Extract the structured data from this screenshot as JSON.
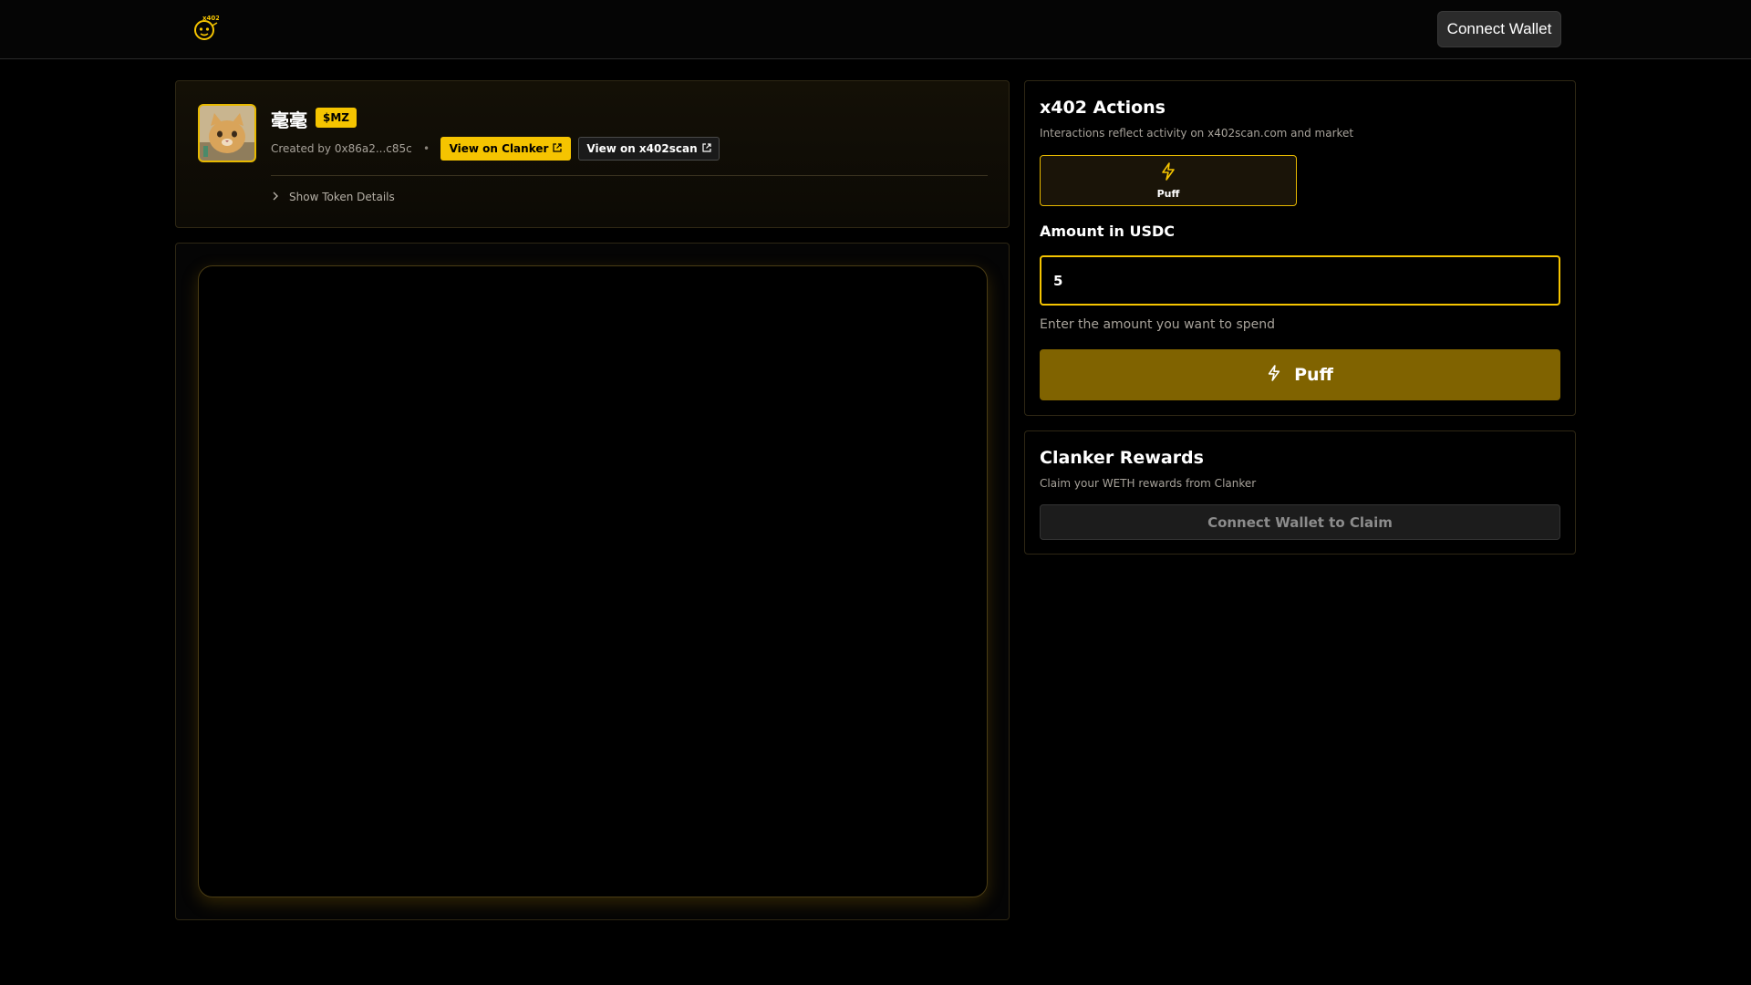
{
  "header": {
    "logo_icon": "x402-mascot-logo",
    "connect_wallet_label": "Connect Wallet"
  },
  "token": {
    "name": "毫毫",
    "ticker": "$MZ",
    "avatar_icon": "cat-avatar",
    "creator_text": "Created by 0x86a2...c85c",
    "separator": "•",
    "view_clanker_label": "View on Clanker",
    "view_x402scan_label": "View on x402scan",
    "show_details_label": "Show Token Details"
  },
  "actions": {
    "title": "x402 Actions",
    "subtitle": "Interactions reflect activity on x402scan.com and market",
    "tab_label": "Puff",
    "amount_label": "Amount in USDC",
    "amount_value": "5",
    "amount_help": "Enter the amount you want to spend",
    "submit_label": "Puff"
  },
  "rewards": {
    "title": "Clanker Rewards",
    "subtitle": "Claim your WETH rewards from Clanker",
    "claim_label": "Connect Wallet to Claim"
  },
  "colors": {
    "accent": "#f5c400",
    "accent_dark": "#806300",
    "background": "#000000"
  }
}
